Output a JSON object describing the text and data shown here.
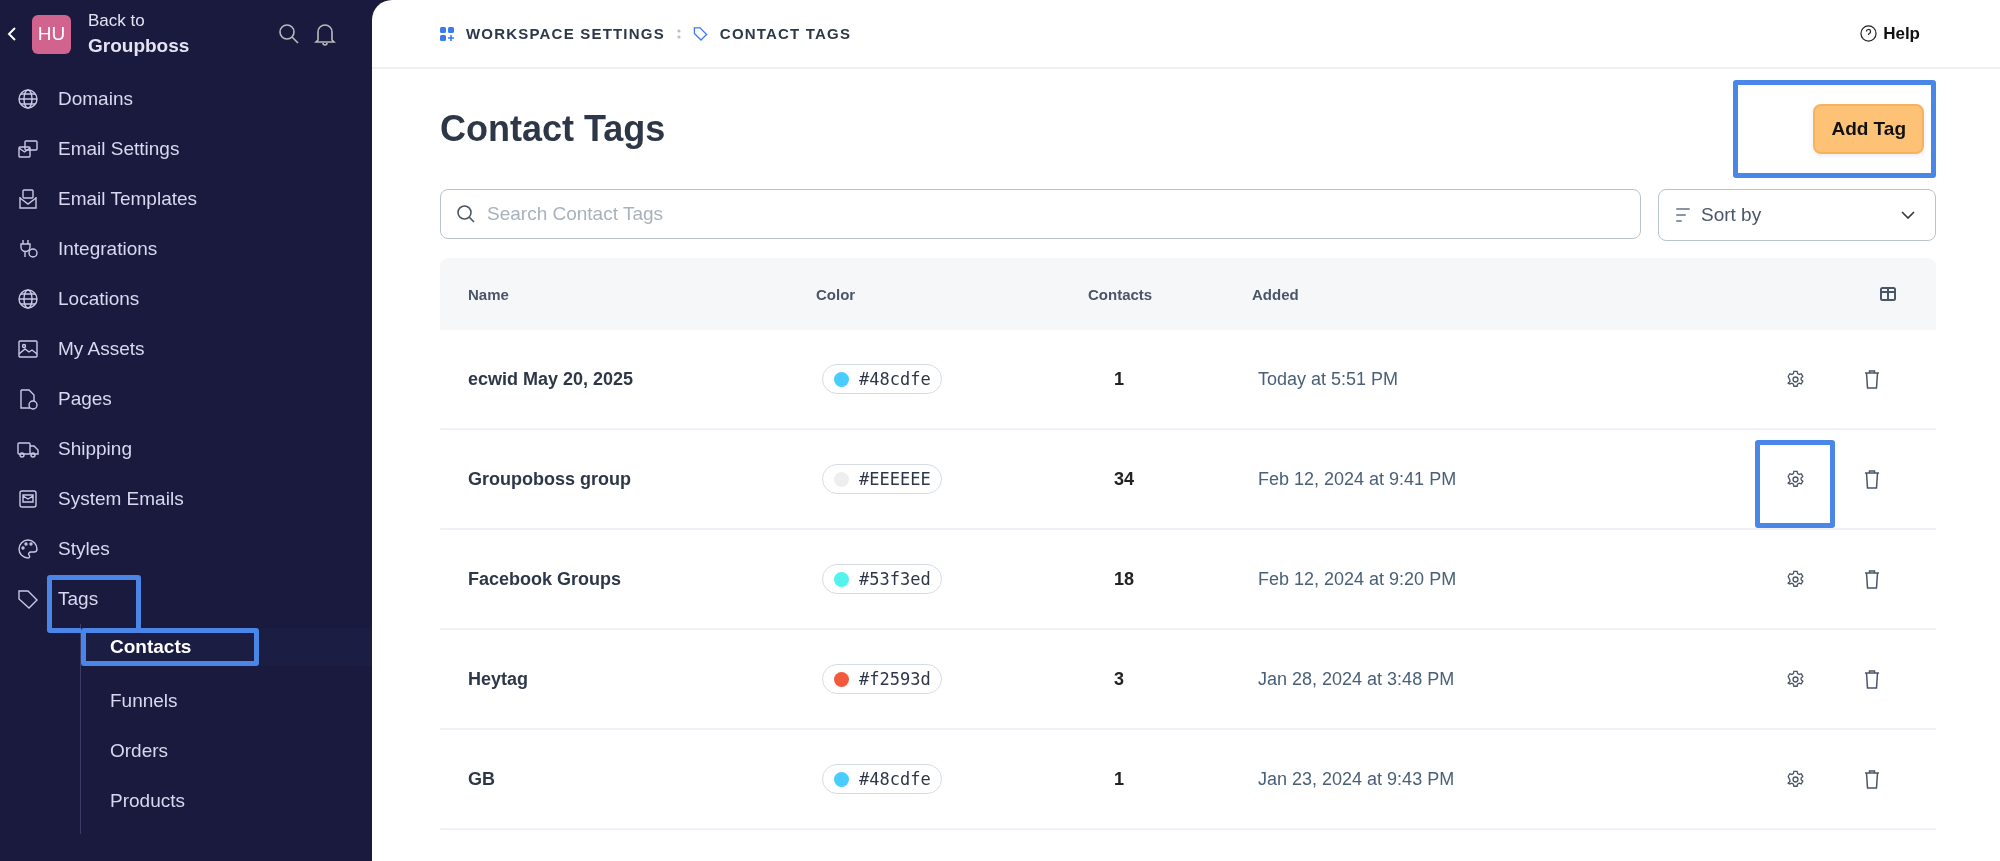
{
  "sidebar": {
    "back_label": "Back to",
    "workspace": "Groupboss",
    "avatar": "HU",
    "items": [
      {
        "label": "Domains",
        "selected": false,
        "highlighted": false
      },
      {
        "label": "Email Settings",
        "selected": false,
        "highlighted": false
      },
      {
        "label": "Email Templates",
        "selected": false,
        "highlighted": false
      },
      {
        "label": "Integrations",
        "selected": false,
        "highlighted": false
      },
      {
        "label": "Locations",
        "selected": false,
        "highlighted": false
      },
      {
        "label": "My Assets",
        "selected": false,
        "highlighted": false
      },
      {
        "label": "Pages",
        "selected": false,
        "highlighted": false
      },
      {
        "label": "Shipping",
        "selected": false,
        "highlighted": false
      },
      {
        "label": "System Emails",
        "selected": false,
        "highlighted": false
      },
      {
        "label": "Styles",
        "selected": false,
        "highlighted": false
      },
      {
        "label": "Tags",
        "selected": false,
        "highlighted": true,
        "expanded": true,
        "children": [
          {
            "label": "Contacts",
            "selected": true,
            "highlighted": true
          },
          {
            "label": "Funnels",
            "selected": false,
            "highlighted": false
          },
          {
            "label": "Orders",
            "selected": false,
            "highlighted": false
          },
          {
            "label": "Products",
            "selected": false,
            "highlighted": false
          }
        ]
      }
    ]
  },
  "breadcrumb": [
    "WORKSPACE SETTINGS",
    "CONTACT TAGS"
  ],
  "help": "Help",
  "title": "Contact Tags",
  "add_button": {
    "label": "Add Tag",
    "highlighted": true
  },
  "search": {
    "placeholder": "Search Contact Tags"
  },
  "sort": {
    "label": "Sort by"
  },
  "table": {
    "columns": [
      "Name",
      "Color",
      "Contacts",
      "Added"
    ],
    "rows": [
      {
        "name": "ecwid May 20, 2025",
        "color": "#48cdfe",
        "color_label": "#48cdfe",
        "contacts": "1",
        "added": "Today at 5:51 PM",
        "settings_highlighted": false
      },
      {
        "name": "Groupoboss group",
        "color": "#eeeeee",
        "color_label": "#EEEEEE",
        "contacts": "34",
        "added": "Feb 12, 2024 at 9:41 PM",
        "settings_highlighted": true
      },
      {
        "name": "Facebook Groups",
        "color": "#53f3ed",
        "color_label": "#53f3ed",
        "contacts": "18",
        "added": "Feb 12, 2024 at 9:20 PM",
        "settings_highlighted": false
      },
      {
        "name": "Heytag",
        "color": "#f2593d",
        "color_label": "#f2593d",
        "contacts": "3",
        "added": "Jan 28, 2024 at 3:48 PM",
        "settings_highlighted": false
      },
      {
        "name": "GB",
        "color": "#48cdfe",
        "color_label": "#48cdfe",
        "contacts": "1",
        "added": "Jan 23, 2024 at 9:43 PM",
        "settings_highlighted": false
      }
    ]
  }
}
